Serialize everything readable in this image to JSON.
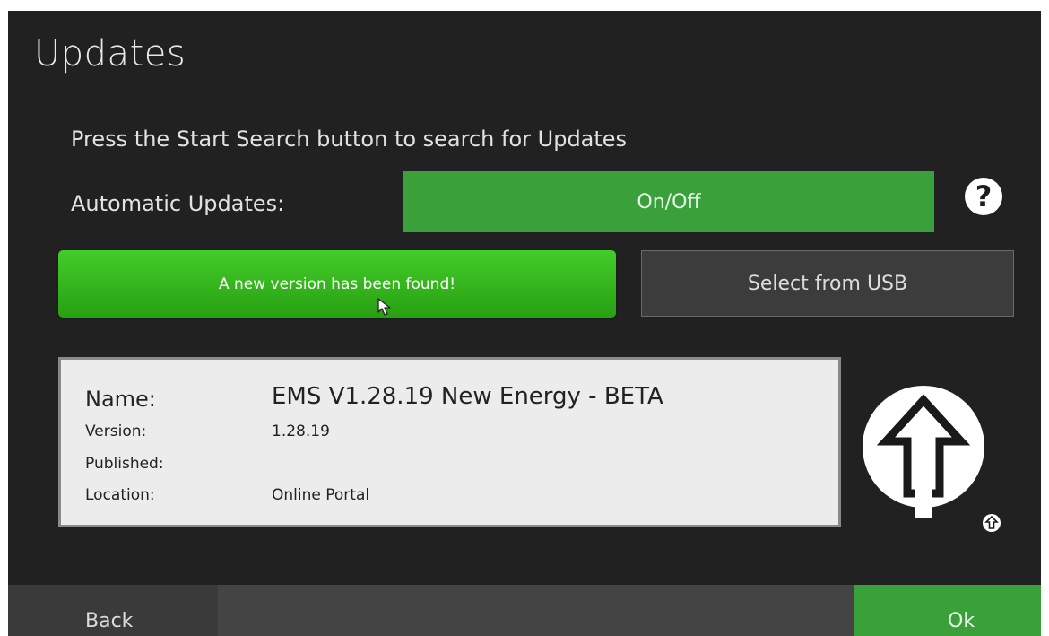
{
  "header": {
    "title": "Updates"
  },
  "instruction": "Press the Start Search button to search for Updates",
  "automatic_updates": {
    "label": "Automatic Updates:",
    "toggle_label": "On/Off"
  },
  "help_button": {
    "label": "?"
  },
  "found_button": {
    "label": "A new version has been found!"
  },
  "usb_button": {
    "label": "Select from USB"
  },
  "update_info": {
    "name_label": "Name:",
    "name_value": "EMS V1.28.19 New Energy - BETA",
    "version_label": "Version:",
    "version_value": "1.28.19",
    "published_label": "Published:",
    "location_label": "Location:",
    "location_value": "Online Portal"
  },
  "footer": {
    "back_label": "Back",
    "ok_label": "Ok"
  },
  "icons": {
    "install": "upload-arrow-icon",
    "small": "small-upload-arrow-icon",
    "help": "question-icon",
    "cursor": "mouse-cursor-icon"
  },
  "colors": {
    "background": "#212121",
    "green": "#3aa03a",
    "bright_green": "#43cc2a",
    "gray_button": "#3c3c3c",
    "info_panel": "#ececec"
  }
}
